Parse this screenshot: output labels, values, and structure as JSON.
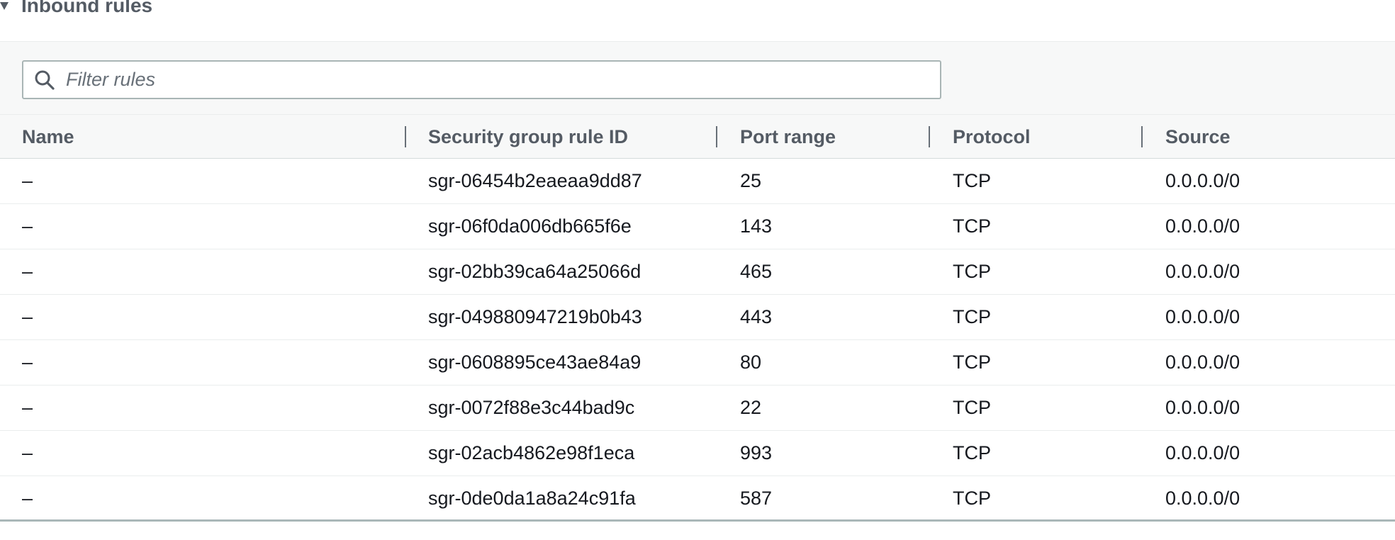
{
  "section": {
    "title": "Inbound rules",
    "expanded": true,
    "caret_icon": "caret-down-icon"
  },
  "filter": {
    "placeholder": "Filter rules",
    "value": "",
    "icon": "search-icon"
  },
  "table": {
    "columns": [
      "Name",
      "Security group rule ID",
      "Port range",
      "Protocol",
      "Source"
    ],
    "rows": [
      {
        "name": "–",
        "rule_id": "sgr-06454b2eaeaa9dd87",
        "port_range": "25",
        "protocol": "TCP",
        "source": "0.0.0.0/0"
      },
      {
        "name": "–",
        "rule_id": "sgr-06f0da006db665f6e",
        "port_range": "143",
        "protocol": "TCP",
        "source": "0.0.0.0/0"
      },
      {
        "name": "–",
        "rule_id": "sgr-02bb39ca64a25066d",
        "port_range": "465",
        "protocol": "TCP",
        "source": "0.0.0.0/0"
      },
      {
        "name": "–",
        "rule_id": "sgr-049880947219b0b43",
        "port_range": "443",
        "protocol": "TCP",
        "source": "0.0.0.0/0"
      },
      {
        "name": "–",
        "rule_id": "sgr-0608895ce43ae84a9",
        "port_range": "80",
        "protocol": "TCP",
        "source": "0.0.0.0/0"
      },
      {
        "name": "–",
        "rule_id": "sgr-0072f88e3c44bad9c",
        "port_range": "22",
        "protocol": "TCP",
        "source": "0.0.0.0/0"
      },
      {
        "name": "–",
        "rule_id": "sgr-02acb4862e98f1eca",
        "port_range": "993",
        "protocol": "TCP",
        "source": "0.0.0.0/0"
      },
      {
        "name": "–",
        "rule_id": "sgr-0de0da1a8a24c91fa",
        "port_range": "587",
        "protocol": "TCP",
        "source": "0.0.0.0/0"
      }
    ]
  },
  "colors": {
    "header_text": "#545b64",
    "body_text": "#16191f",
    "header_bg": "#f7f8f8",
    "border": "#eaeded",
    "input_border": "#a9b5b5"
  }
}
